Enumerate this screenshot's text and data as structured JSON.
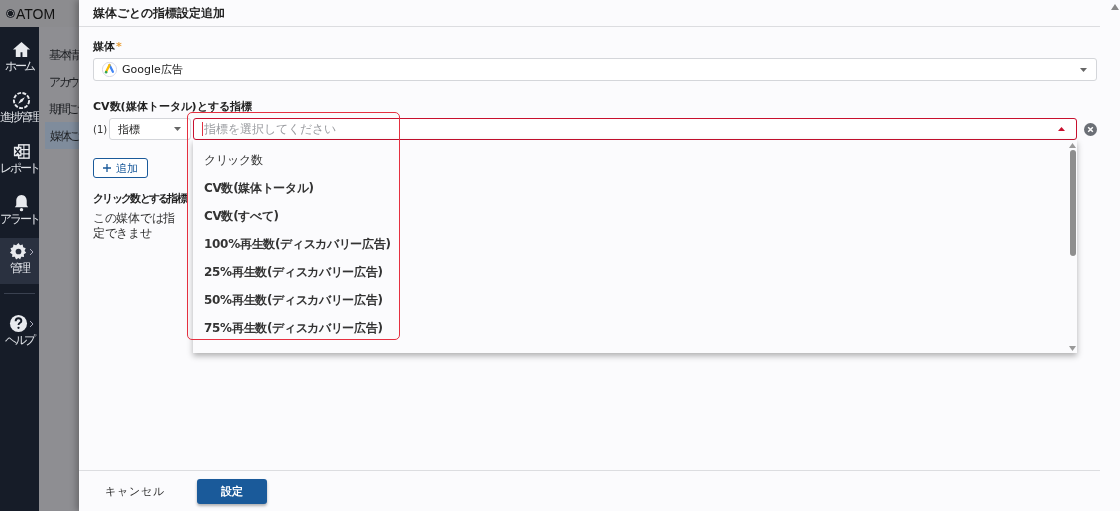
{
  "app": {
    "logo": "ATOM",
    "nav": [
      {
        "kind": "home",
        "label": "ホーム",
        "selected": false,
        "submenu": false
      },
      {
        "kind": "progress",
        "label": "進捗管理",
        "selected": false,
        "submenu": false
      },
      {
        "kind": "report",
        "label": "レポート",
        "selected": false,
        "submenu": false
      },
      {
        "kind": "alert",
        "label": "アラート",
        "selected": false,
        "submenu": false
      },
      {
        "kind": "settings",
        "label": "管理",
        "selected": true,
        "submenu": true
      },
      {
        "kind": "help",
        "label": "ヘルプ",
        "selected": false,
        "submenu": true
      }
    ],
    "subnav": [
      {
        "label": "基本情",
        "selected": false
      },
      {
        "label": "アカウ",
        "selected": false
      },
      {
        "label": "期間ご",
        "selected": false
      },
      {
        "label": "媒体ご",
        "selected": true
      }
    ]
  },
  "drawer": {
    "title": "媒体ごとの指標設定追加",
    "media": {
      "label": "媒体",
      "required_mark": "*",
      "value": "Google広告"
    },
    "cv_metric": {
      "label": "CV数(媒体トータル)とする指標",
      "rows": [
        {
          "index": "(1)",
          "type": "指標",
          "placeholder": "指標を選択してください",
          "open": true
        }
      ],
      "options": [
        "クリック数",
        "CV数(媒体トータル)",
        "CV数(すべて)",
        "100%再生数(ディスカバリー広告)",
        "25%再生数(ディスカバリー広告)",
        "50%再生数(ディスカバリー広告)",
        "75%再生数(ディスカバリー広告)"
      ],
      "add_button": "追加"
    },
    "click_metric": {
      "label": "クリック数とする指標",
      "note": "この媒体では指定できませ"
    },
    "footer": {
      "cancel": "キャンセル",
      "submit": "設定"
    }
  }
}
